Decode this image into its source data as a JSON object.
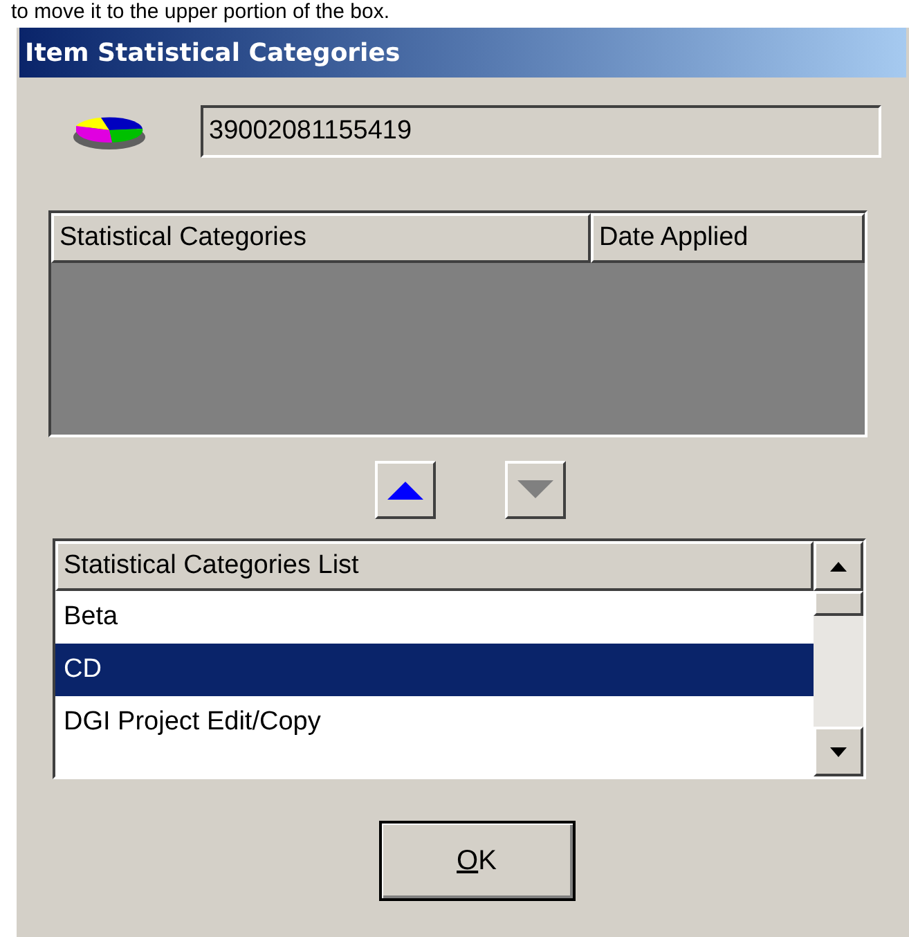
{
  "caption": "to move it to the upper portion of the box.",
  "window": {
    "title": "Item Statistical Categories"
  },
  "item_barcode": {
    "value": "39002081155419"
  },
  "applied_table": {
    "columns": [
      "Statistical Categories",
      "Date Applied"
    ]
  },
  "move_buttons": [
    {
      "kind": "up",
      "disabled": false
    },
    {
      "kind": "down",
      "disabled": true
    }
  ],
  "categories_list": {
    "header": "Statistical Categories List",
    "items": [
      {
        "label": "Beta",
        "selected": false
      },
      {
        "label": "CD",
        "selected": true
      },
      {
        "label": "DGI Project Edit/Copy",
        "selected": false
      }
    ]
  },
  "ok_button": {
    "label": "OK",
    "first_letter_underlined": true
  }
}
